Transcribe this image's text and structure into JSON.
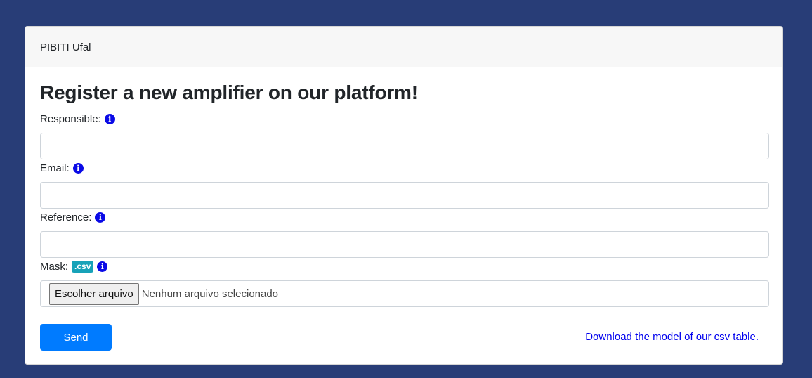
{
  "header": {
    "title": "PIBITI Ufal"
  },
  "form": {
    "title": "Register a new amplifier on our platform!",
    "fields": {
      "responsible": {
        "label": "Responsible:",
        "value": "",
        "icon": "info-icon"
      },
      "email": {
        "label": "Email:",
        "value": "",
        "icon": "info-icon"
      },
      "reference": {
        "label": "Reference:",
        "value": "",
        "icon": "info-icon"
      },
      "mask": {
        "label": "Mask:",
        "badge": ".csv",
        "icon": "info-icon",
        "file_button_label": "Escolher arquivo",
        "file_status": "Nenhum arquivo selecionado"
      }
    },
    "send_label": "Send",
    "download_link": "Download the model of our csv table."
  },
  "colors": {
    "background": "#283d77",
    "primary": "#007bff",
    "info_badge": "#17a2b8",
    "info_icon": "#0a0ae6",
    "link": "#0000ee"
  }
}
